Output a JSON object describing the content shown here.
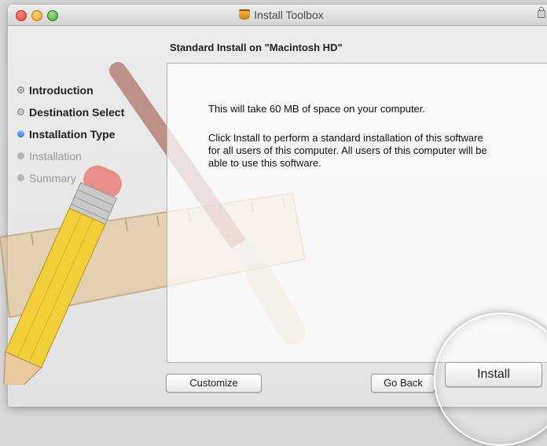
{
  "window": {
    "title": "Install Toolbox",
    "panel_title": "Standard Install on \"Macintosh HD\""
  },
  "steps": [
    {
      "label": "Introduction",
      "state": "done"
    },
    {
      "label": "Destination Select",
      "state": "done"
    },
    {
      "label": "Installation Type",
      "state": "current"
    },
    {
      "label": "Installation",
      "state": "future"
    },
    {
      "label": "Summary",
      "state": "future"
    }
  ],
  "content": {
    "space_text": "This will take 60 MB of space on your computer.",
    "description": "Click Install to perform a standard installation of this software for all users of this computer. All users of this computer will be able to use this software."
  },
  "buttons": {
    "customize": "Customize",
    "go_back": "Go Back",
    "install": "Install"
  },
  "icons": {
    "title_icon": "package-icon",
    "lock": "lock-icon",
    "artwork": "pencil-brush-ruler-art"
  },
  "colors": {
    "current_step": "#2b78e4",
    "window_bg": "#ececec"
  }
}
